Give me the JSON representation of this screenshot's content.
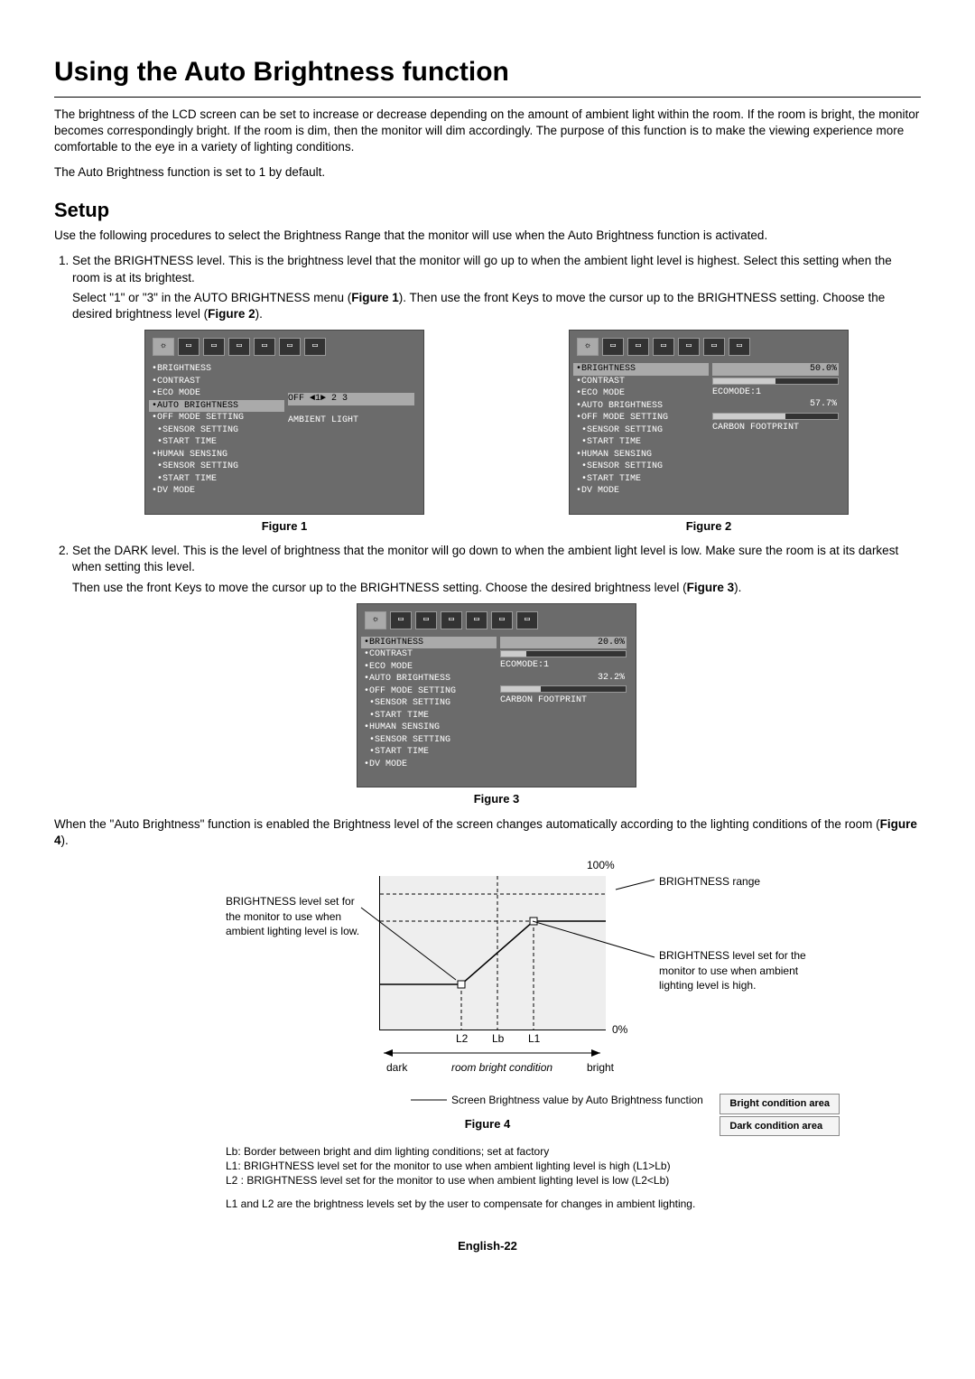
{
  "title": "Using the Auto Brightness function",
  "intro1": "The brightness of the LCD screen can be set to increase or decrease depending on the amount of ambient light within the room. If the room is bright, the monitor becomes correspondingly bright. If the room is dim, then the monitor will dim accordingly. The purpose of this function is to make the viewing experience more comfortable to the eye in a variety of lighting conditions.",
  "intro2": "The Auto Brightness function is set to 1 by default.",
  "setup_heading": "Setup",
  "setup_lead": "Use the following procedures to select the Brightness Range that the monitor will use when the Auto Brightness function is activated.",
  "step1a": "Set the BRIGHTNESS level. This is the brightness level that the monitor will go up to when the ambient light level is highest. Select this setting when the room is at its brightest.",
  "step1b_pre": "Select \"1\" or \"3\" in the AUTO BRIGHTNESS menu (",
  "fig1_ref": "Figure 1",
  "step1b_mid": "). Then use the front Keys to move the cursor up to the BRIGHTNESS setting. Choose the desired brightness level (",
  "fig2_ref": "Figure 2",
  "step1b_post": ").",
  "step2a": "Set the DARK level. This is the level of brightness that the monitor will go down to when the ambient light level is low. Make sure the room is at its darkest when setting this level.",
  "step2b_pre": "Then use the front Keys to move the cursor up to the BRIGHTNESS setting. Choose the desired brightness level (",
  "fig3_ref": "Figure 3",
  "step2b_post": ").",
  "post_pre": "When the \"Auto Brightness\" function is enabled the Brightness level of the screen changes automatically according to the lighting conditions of the room (",
  "fig4_ref": "Figure 4",
  "post_post": ").",
  "osd_menu": [
    "•BRIGHTNESS",
    "•CONTRAST",
    "•ECO MODE",
    "•AUTO BRIGHTNESS",
    "•OFF MODE SETTING",
    " •SENSOR SETTING",
    " •START TIME",
    "•HUMAN SENSING",
    " •SENSOR SETTING",
    " •START TIME",
    "•DV MODE"
  ],
  "fig1": {
    "selected": "•AUTO BRIGHTNESS",
    "right_top": "OFF   ◄1► 2  3",
    "right_bot": "AMBIENT LIGHT"
  },
  "fig2": {
    "selected": "•BRIGHTNESS",
    "brightness": "50.0%",
    "ecomode": "ECOMODE:1",
    "carbon": "57.7%",
    "footprint": "CARBON FOOTPRINT"
  },
  "fig3": {
    "selected": "•BRIGHTNESS",
    "brightness": "20.0%",
    "ecomode": "ECOMODE:1",
    "carbon": "32.2%",
    "footprint": "CARBON FOOTPRINT"
  },
  "captions": {
    "f1": "Figure 1",
    "f2": "Figure 2",
    "f3": "Figure 3",
    "f4": "Figure 4"
  },
  "fig4_labels": {
    "hundred": "100%",
    "zero": "0%",
    "l2": "L2",
    "lb": "Lb",
    "l1": "L1",
    "dark": "dark",
    "room": "room bright condition",
    "bright": "bright",
    "left": "BRIGHTNESS level set for the monitor to use when ambient lighting level is low.",
    "range": "BRIGHTNESS range",
    "high": "BRIGHTNESS level set for the monitor to use when ambient lighting level is high.",
    "legend_bright": "Bright condition area",
    "legend_dark": "Dark condition area",
    "legend_line": "Screen Brightness value by Auto Brightness function"
  },
  "notes": {
    "n1": "Lb: Border between bright and dim lighting conditions; set at factory",
    "n2": "L1: BRIGHTNESS level set for the monitor to use when ambient lighting level is high (L1>Lb)",
    "n3": "L2 : BRIGHTNESS level set for the monitor to use when ambient lighting level is low (L2<Lb)",
    "n4": "L1 and L2 are the brightness levels set by the user to compensate for changes in ambient lighting."
  },
  "footer": "English-22"
}
